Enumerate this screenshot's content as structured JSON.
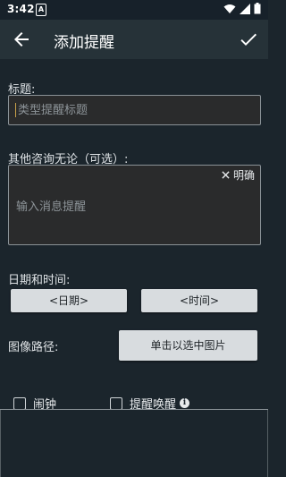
{
  "status_bar": {
    "time": "3:42",
    "sim_label": "A"
  },
  "app_bar": {
    "title": "添加提醒"
  },
  "form": {
    "title_label": "标题:",
    "title_placeholder": "类型提醒标题",
    "message_label": "其他咨询无论（可选）:",
    "message_clear_label": "明确",
    "message_placeholder": "输入消息提醒",
    "datetime_label": "日期和时间:",
    "date_button": "<日期>",
    "time_button": "<时间>",
    "image_label": "图像路径:",
    "image_button": "单击以选中图片",
    "alarm_label": "闹钟",
    "wake_label": "提醒唤醒",
    "info_glyph": "i"
  },
  "icons": [
    "back-arrow-icon",
    "check-icon",
    "close-icon",
    "info-icon",
    "wifi-icon",
    "signal-icon",
    "battery-icon"
  ]
}
